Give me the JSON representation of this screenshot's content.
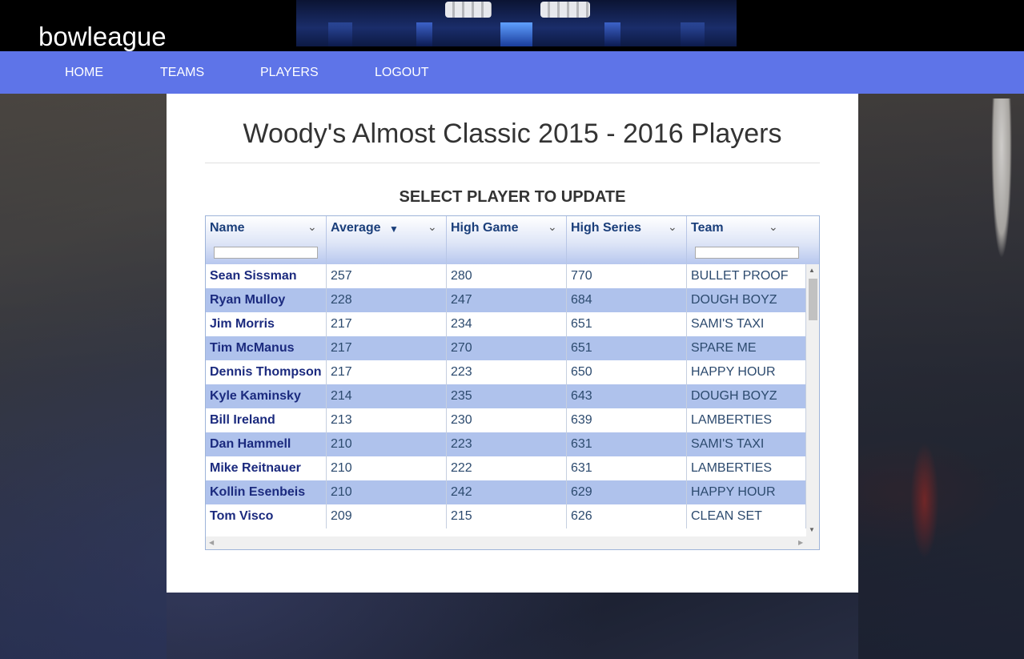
{
  "brand": "bowleague",
  "nav": [
    {
      "label": "HOME"
    },
    {
      "label": "TEAMS"
    },
    {
      "label": "PLAYERS"
    },
    {
      "label": "LOGOUT"
    }
  ],
  "page": {
    "title": "Woody's Almost Classic 2015 - 2016 Players",
    "section_title": "SELECT PLAYER TO UPDATE"
  },
  "grid": {
    "columns": [
      {
        "label": "Name",
        "sorted": false,
        "filter": true
      },
      {
        "label": "Average",
        "sorted": true,
        "sort_direction": "descending",
        "filter": false
      },
      {
        "label": "High Game",
        "sorted": false,
        "filter": false
      },
      {
        "label": "High Series",
        "sorted": false,
        "filter": false
      },
      {
        "label": "Team",
        "sorted": false,
        "filter": true
      }
    ],
    "rows": [
      [
        "Sean Sissman",
        "257",
        "280",
        "770",
        "BULLET PROOF"
      ],
      [
        "Ryan Mulloy",
        "228",
        "247",
        "684",
        "DOUGH BOYZ"
      ],
      [
        "Jim Morris",
        "217",
        "234",
        "651",
        "SAMI'S TAXI"
      ],
      [
        "Tim McManus",
        "217",
        "270",
        "651",
        "SPARE ME"
      ],
      [
        "Dennis Thompson",
        "217",
        "223",
        "650",
        "HAPPY HOUR"
      ],
      [
        "Kyle Kaminsky",
        "214",
        "235",
        "643",
        "DOUGH BOYZ"
      ],
      [
        "Bill Ireland",
        "213",
        "230",
        "639",
        "LAMBERTIES"
      ],
      [
        "Dan Hammell",
        "210",
        "223",
        "631",
        "SAMI'S TAXI"
      ],
      [
        "Mike Reitnauer",
        "210",
        "222",
        "631",
        "LAMBERTIES"
      ],
      [
        "Kollin Esenbeis",
        "210",
        "242",
        "629",
        "HAPPY HOUR"
      ],
      [
        "Tom Visco",
        "209",
        "215",
        "626",
        "CLEAN SET"
      ]
    ]
  }
}
